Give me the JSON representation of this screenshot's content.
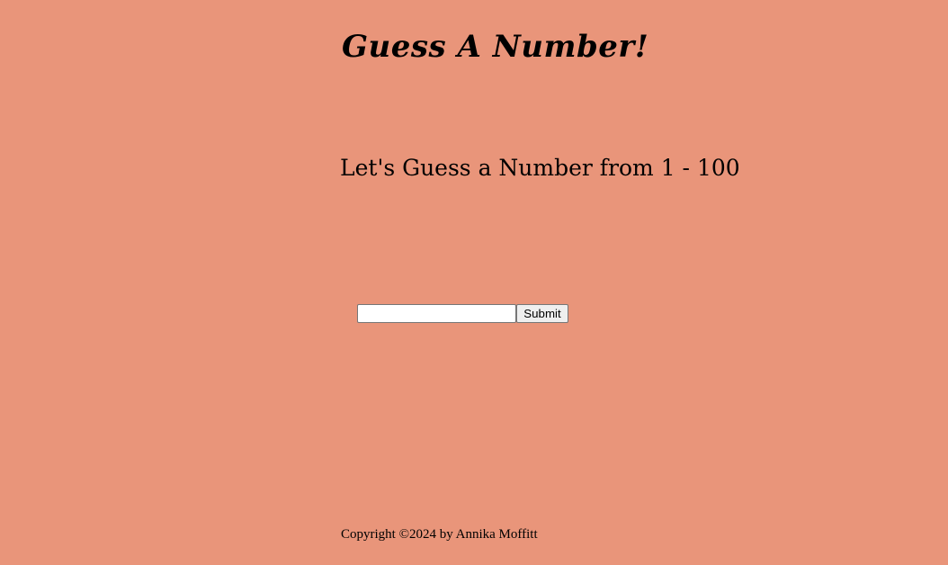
{
  "page": {
    "title": "Guess A Number!",
    "subtitle": "Let's Guess a Number from 1 - 100",
    "background_color": "#e9957a"
  },
  "form": {
    "input_value": "",
    "submit_label": "Submit"
  },
  "footer": {
    "copyright": "Copyright ©2024 by Annika Moffitt"
  }
}
